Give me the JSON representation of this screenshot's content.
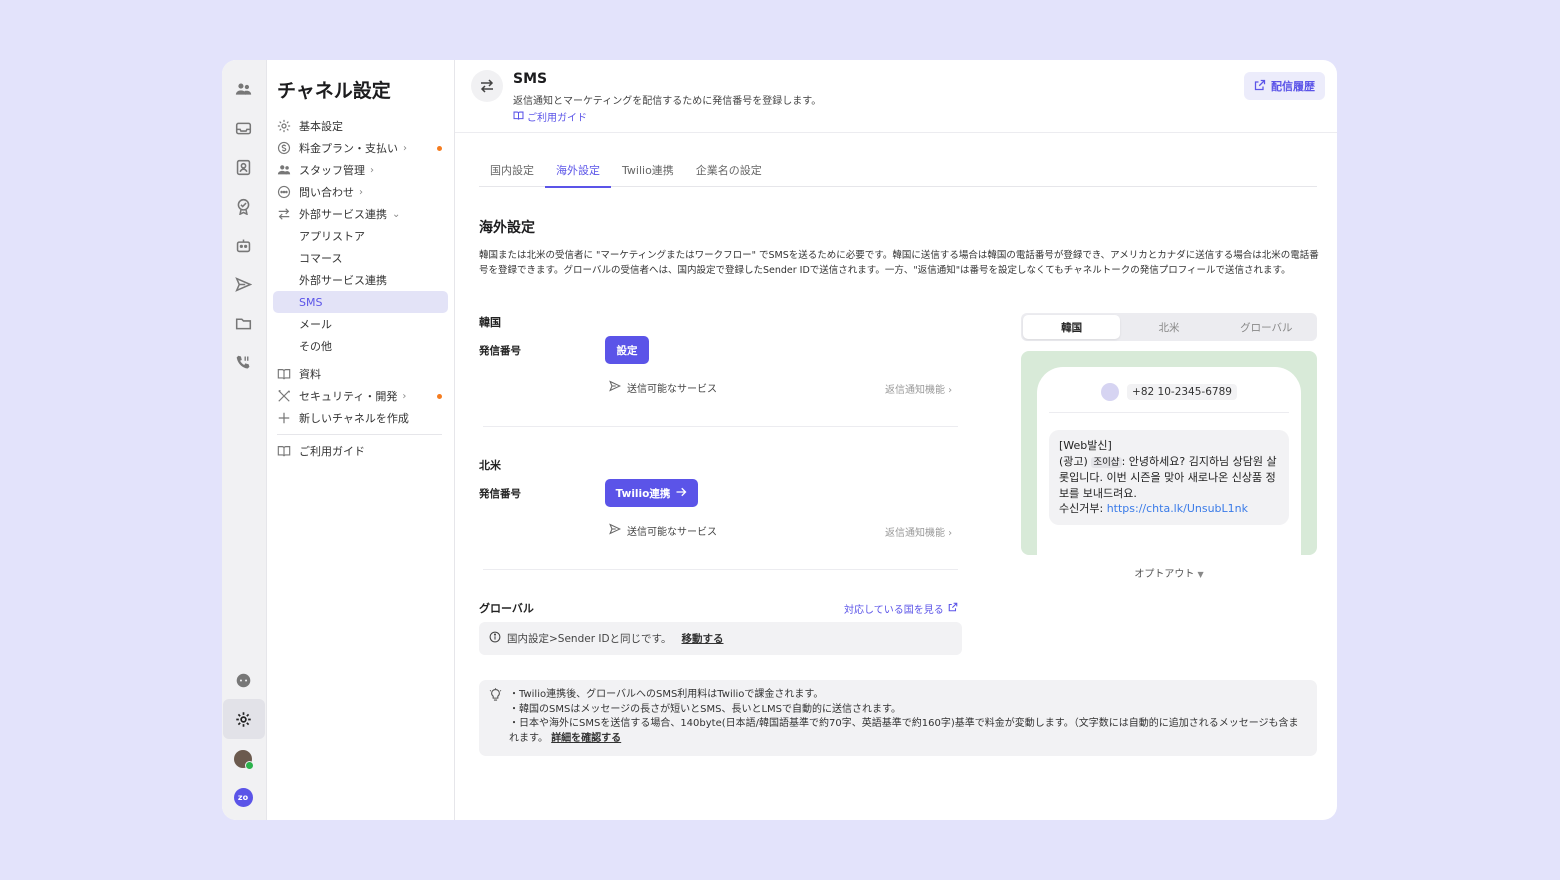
{
  "sidebar": {
    "title": "チャネル設定",
    "items": [
      {
        "label": "基本設定"
      },
      {
        "label": "料金プラン・支払い"
      },
      {
        "label": "スタッフ管理"
      },
      {
        "label": "問い合わせ"
      },
      {
        "label": "外部サービス連携"
      }
    ],
    "sub_items": [
      "アプリストア",
      "コマース",
      "外部サービス連携",
      "SMS",
      "メール",
      "その他"
    ],
    "bottom_items": [
      {
        "label": "資料"
      },
      {
        "label": "セキュリティ・開発"
      },
      {
        "label": "新しいチャネルを作成"
      }
    ],
    "guide_label": "ご利用ガイド"
  },
  "header": {
    "title": "SMS",
    "description": "返信通知とマーケティングを配信するために発信番号を登録します。",
    "guide_link": "ご利用ガイド",
    "history_button": "配信履歴"
  },
  "tabs": [
    "国内設定",
    "海外設定",
    "Twilio連携",
    "企業名の設定"
  ],
  "section": {
    "title": "海外設定",
    "description": "韓国または北米の受信者に \"マーケティングまたはワークフロー\" でSMSを送るために必要です。韓国に送信する場合は韓国の電話番号が登録でき、アメリカとカナダに送信する場合は北米の電話番号を登録できます。グローバルの受信者へは、国内設定で登録したSender IDで送信されます。一方、\"返信通知\"は番号を設定しなくてもチャネルトークの発信プロフィールで送信されます。"
  },
  "korea": {
    "title": "韓国",
    "number_label": "発信番号",
    "button": "設定",
    "services": "送信可能なサービス",
    "reply_feature": "返信通知機能"
  },
  "north_america": {
    "title": "北米",
    "number_label": "発信番号",
    "button": "Twilio連携",
    "services": "送信可能なサービス",
    "reply_feature": "返信通知機能"
  },
  "global": {
    "title": "グローバル",
    "link": "対応している国を見る",
    "info": "国内設定>Sender IDと同じです。",
    "info_link": "移動する"
  },
  "preview": {
    "segments": [
      "韓国",
      "北米",
      "グローバル"
    ],
    "phone_number": "+82 10-2345-6789",
    "msg_line1": "[Web발신]",
    "msg_prefix": "(광고)",
    "msg_tag": "조이샵",
    "msg_body": ": 안녕하세요? 김지하님 상담원 살롯입니다. 이번 시즌을 맞아 새로나온 신상품 정보를 보내드려요.",
    "msg_unsub_label": "수신거부: ",
    "msg_unsub_url": "https://chta.lk/UnsubL1nk",
    "optout": "オプトアウト"
  },
  "tips": {
    "line1": "・Twilio連携後、グローバルへのSMS利用料はTwilioで課金されます。",
    "line2": "・韓国のSMSはメッセージの長さが短いとSMS、長いとLMSで自動的に送信されます。",
    "line3": "・日本や海外にSMSを送信する場合、140byte(日本語/韓国語基準で約70字、英語基準で約160字)基準で料金が変動します。（文字数には自動的に追加されるメッセージも含まれます。",
    "link": "詳細を確認する"
  },
  "colors": {
    "accent": "#5b54e8",
    "background": "#e3e3fb",
    "notification_dot": "#f57c1f",
    "preview_bg": "#d8ead8"
  }
}
